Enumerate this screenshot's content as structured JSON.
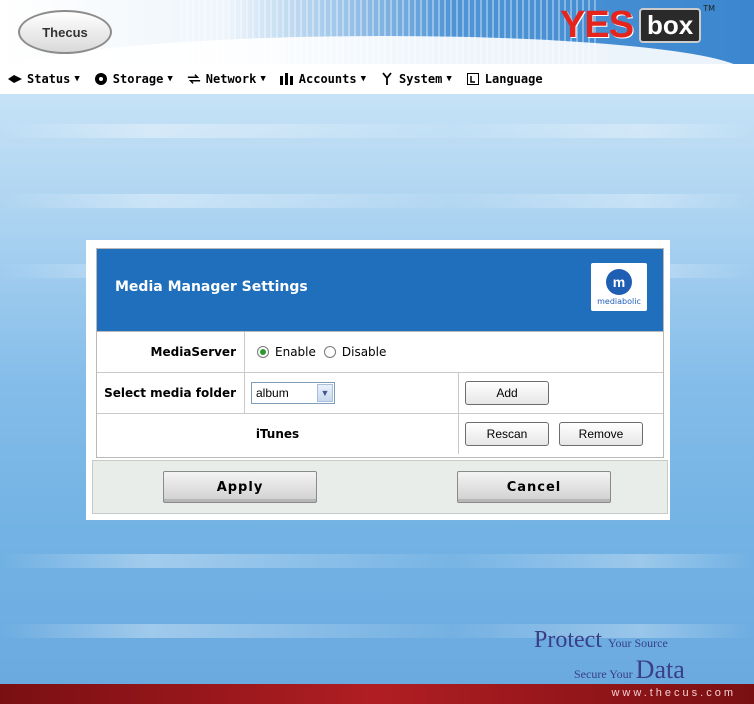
{
  "header": {
    "left_logo": "Thecus",
    "right_logo_yes": "YES",
    "right_logo_box": "box",
    "right_logo_tm": "TM"
  },
  "menu": [
    {
      "label": "Status",
      "icon": "status-icon"
    },
    {
      "label": "Storage",
      "icon": "storage-icon"
    },
    {
      "label": "Network",
      "icon": "network-icon"
    },
    {
      "label": "Accounts",
      "icon": "accounts-icon"
    },
    {
      "label": "System",
      "icon": "system-icon"
    },
    {
      "label": "Language",
      "icon": "language-icon"
    }
  ],
  "dialog": {
    "title": "Media Manager Settings",
    "logo_text": "mediabolic",
    "media_server_label": "MediaServer",
    "enable_label": "Enable",
    "disable_label": "Disable",
    "media_server_selected": "Enable",
    "folder_label": "Select media folder",
    "folder_value": "album",
    "add_label": "Add",
    "itunes_label": "iTunes",
    "rescan_label": "Rescan",
    "remove_label": "Remove",
    "apply_label": "Apply",
    "cancel_label": "Cancel"
  },
  "slogan": {
    "protect": "Protect",
    "your_source": "Your Source",
    "secure_your": "Secure Your",
    "data": "Data"
  },
  "footer": {
    "url": "www.thecus.com"
  },
  "colors": {
    "panel_header": "#1f6fbd",
    "footer": "#b01e23",
    "accent_logo": "#e4241d"
  }
}
